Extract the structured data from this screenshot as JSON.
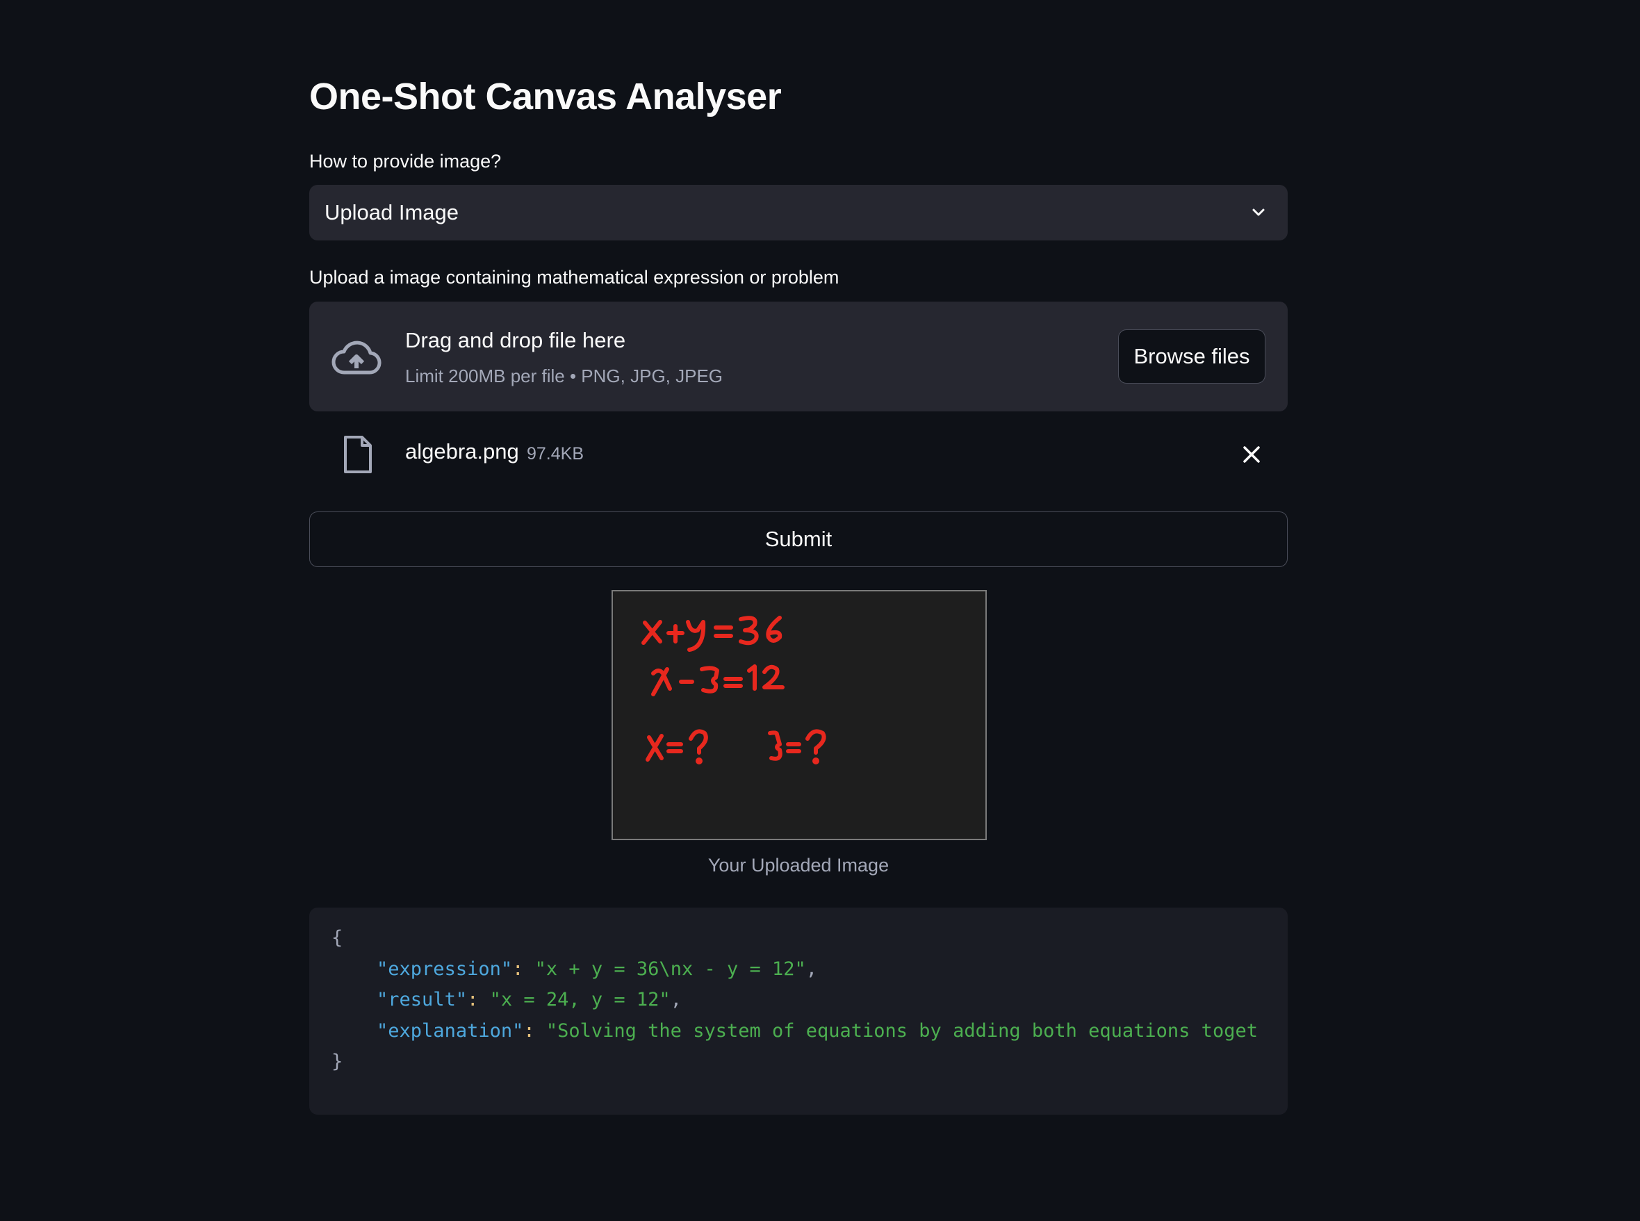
{
  "app": {
    "title": "One-Shot Canvas Analyser"
  },
  "input_mode": {
    "label": "How to provide image?",
    "selected": "Upload Image"
  },
  "uploader": {
    "label": "Upload a image containing mathematical expression or problem",
    "drop_title": "Drag and drop file here",
    "drop_hint": "Limit 200MB per file • PNG, JPG, JPEG",
    "browse_label": "Browse files",
    "file": {
      "name": "algebra.png",
      "size": "97.4KB"
    }
  },
  "submit_label": "Submit",
  "preview": {
    "caption": "Your Uploaded Image",
    "lines": [
      "x+y = 36",
      "x-y = 12",
      "x=?   y=?"
    ],
    "ink_color": "#e8281e"
  },
  "result": {
    "open_brace": "{",
    "close_brace": "}",
    "fields": [
      {
        "key": "\"expression\"",
        "value": "\"x + y = 36\\nx - y = 12\"",
        "comma": ","
      },
      {
        "key": "\"result\"",
        "value": "\"x = 24, y = 12\"",
        "comma": ","
      },
      {
        "key": "\"explanation\"",
        "value": "\"Solving the system of equations by adding both equations toget",
        "comma": ""
      }
    ]
  }
}
